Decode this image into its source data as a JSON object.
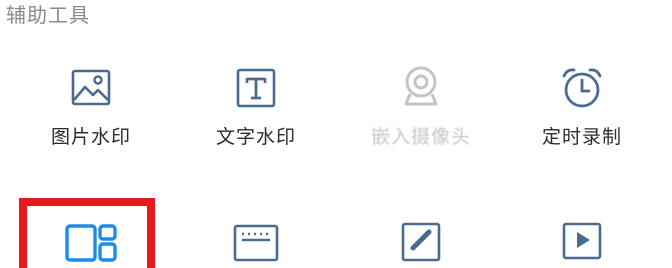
{
  "section": {
    "title": "辅助工具"
  },
  "tools": [
    {
      "label": "图片水印",
      "icon": "image-icon",
      "enabled": true
    },
    {
      "label": "文字水印",
      "icon": "text-icon",
      "enabled": true
    },
    {
      "label": "嵌入摄像头",
      "icon": "webcam-icon",
      "enabled": false
    },
    {
      "label": "定时录制",
      "icon": "alarm-clock-icon",
      "enabled": true
    }
  ],
  "tools_row2": [
    {
      "icon": "layout-split-icon",
      "highlighted": true
    },
    {
      "icon": "keyboard-icon",
      "highlighted": false
    },
    {
      "icon": "pen-edit-icon",
      "highlighted": false
    },
    {
      "icon": "play-video-icon",
      "highlighted": false
    }
  ],
  "colors": {
    "icon_blue": "#4a6a8f",
    "icon_disabled": "#c4c4c4",
    "highlight_icon": "#1e8be6",
    "highlight_frame": "#e8191a",
    "section_title": "#8a8a8a"
  }
}
